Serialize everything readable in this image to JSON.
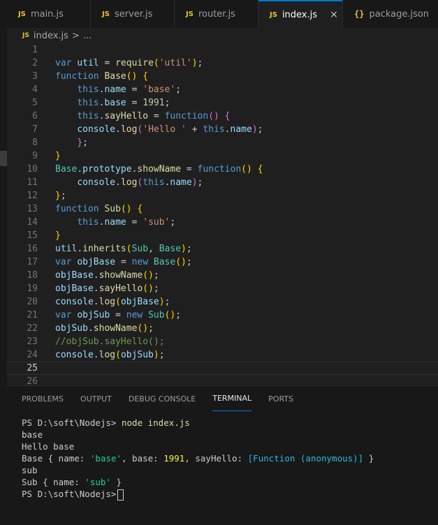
{
  "tabs": [
    {
      "icon": "JS",
      "label": "main.js",
      "active": false
    },
    {
      "icon": "JS",
      "label": "server.js",
      "active": false
    },
    {
      "icon": "JS",
      "label": "router.js",
      "active": false
    },
    {
      "icon": "JS",
      "label": "index.js",
      "active": true,
      "close": "×"
    },
    {
      "icon": "{}",
      "label": "package.json",
      "active": false
    }
  ],
  "breadcrumb": {
    "icon": "JS",
    "file": "index.js",
    "sep": ">",
    "rest": "..."
  },
  "editor": {
    "line_numbers": [
      "1",
      "2",
      "3",
      "4",
      "5",
      "6",
      "7",
      "8",
      "9",
      "10",
      "11",
      "12",
      "13",
      "14",
      "15",
      "16",
      "17",
      "18",
      "19",
      "20",
      "21",
      "22",
      "23",
      "24",
      "25",
      "26"
    ],
    "current_line": "25",
    "lines": [
      "",
      "var util = require('util');",
      "function Base() {",
      "    this.name = 'base';",
      "    this.base = 1991;",
      "    this.sayHello = function() {",
      "    console.log('Hello ' + this.name);",
      "    };",
      "}",
      "Base.prototype.showName = function() {",
      "    console.log(this.name);",
      "};",
      "function Sub() {",
      "    this.name = 'sub';",
      "}",
      "util.inherits(Sub, Base);",
      "var objBase = new Base();",
      "objBase.showName();",
      "objBase.sayHello();",
      "console.log(objBase);",
      "var objSub = new Sub();",
      "objSub.showName();",
      "//objSub.sayHello();",
      "console.log(objSub);",
      "",
      ""
    ]
  },
  "panel": {
    "tabs": [
      "PROBLEMS",
      "OUTPUT",
      "DEBUG CONSOLE",
      "TERMINAL",
      "PORTS"
    ],
    "active_tab": "TERMINAL"
  },
  "terminal": {
    "prompt": "PS D:\\soft\\Nodejs>",
    "command": "node index.js",
    "output": [
      "base",
      "Hello base",
      "Base { name: 'base', base: 1991, sayHello: [Function (anonymous)] }",
      "sub",
      "Sub { name: 'sub' }"
    ]
  },
  "colors": {
    "accent": "#0078d4",
    "editor_bg": "#1f1f1f",
    "panel_bg": "#181818",
    "js_icon": "#e8c33c"
  },
  "icons": {
    "js_file": "js-file-icon",
    "json_file": "json-file-icon",
    "close": "close-icon"
  }
}
